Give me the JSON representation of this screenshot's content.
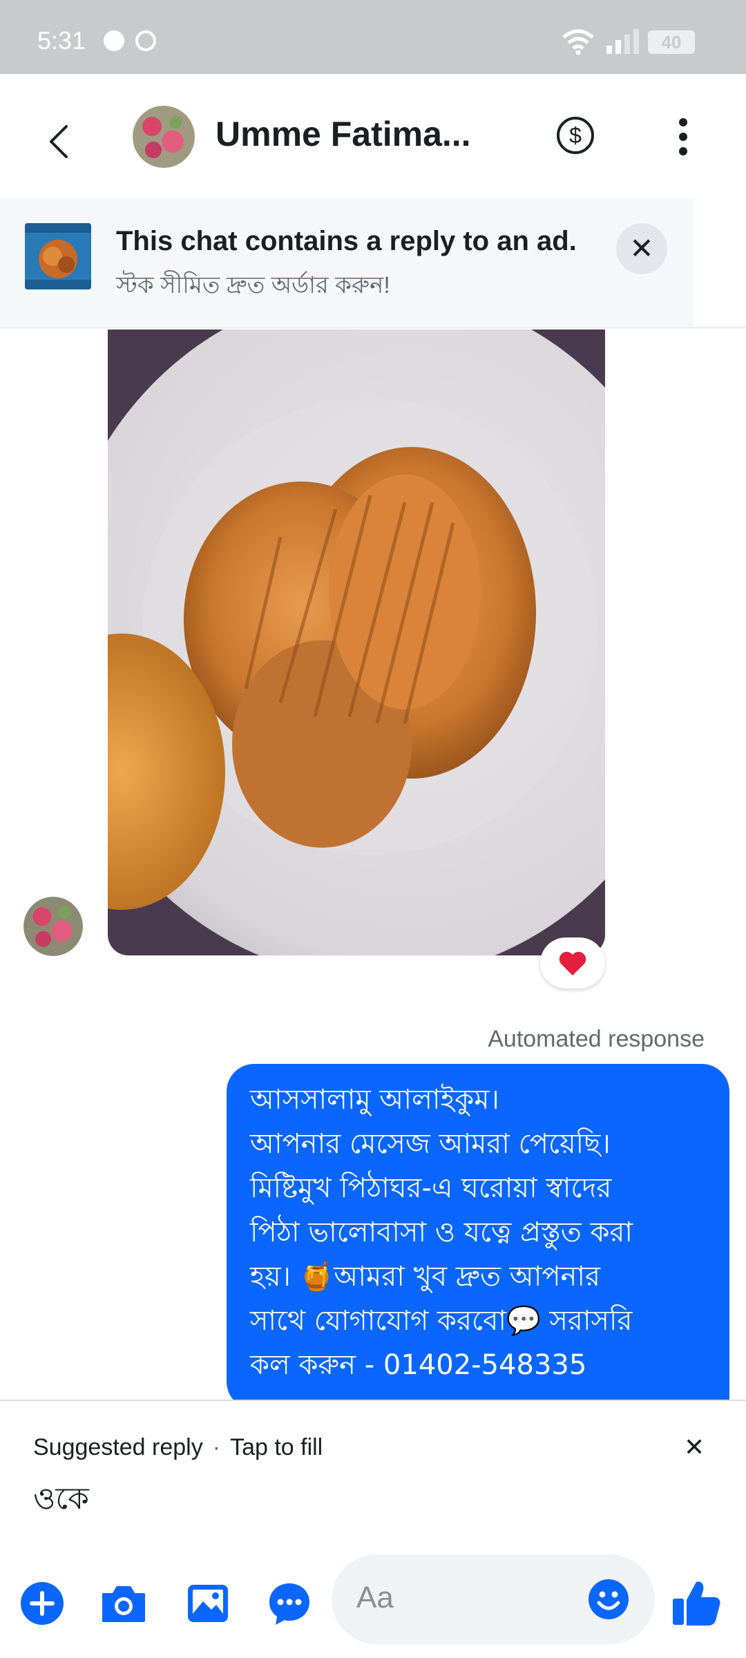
{
  "status_bar": {
    "time": "5:31",
    "battery": "40"
  },
  "header": {
    "contact_name": "Umme Fatima..."
  },
  "ad_banner": {
    "title": "This chat contains a reply to an ad.",
    "subtitle": "স্টক সীমিত দ্রুত অর্ডার করুন!"
  },
  "reaction": "❤️",
  "automated_label": "Automated response",
  "message": {
    "lines": [
      "আসসালামু আলাইকুম।",
      "আপনার মেসেজ আমরা পেয়েছি।",
      "মিষ্টিমুখ পিঠাঘর-এ ঘরোয়া স্বাদের",
      "পিঠা ভালোবাসা ও যত্নে প্রস্তুত করা",
      "হয়। 🍯আমরা খুব দ্রুত আপনার",
      "সাথে যোগাযোগ করবো💬 সরাসরি",
      "কল করুন - 01402-548335"
    ]
  },
  "suggested_reply": {
    "label": "Suggested reply",
    "hint": "Tap to fill",
    "text": "ওকে"
  },
  "composer": {
    "placeholder": "Aa"
  },
  "colors": {
    "accent": "#0a66ff",
    "status_bar": "#c9cacc"
  },
  "icons": [
    "back-icon",
    "dollar-icon",
    "more-icon",
    "close-icon",
    "heart-icon",
    "plus-icon",
    "camera-icon",
    "gallery-icon",
    "chat-bubble-icon",
    "emoji-icon",
    "thumbs-up-icon"
  ]
}
